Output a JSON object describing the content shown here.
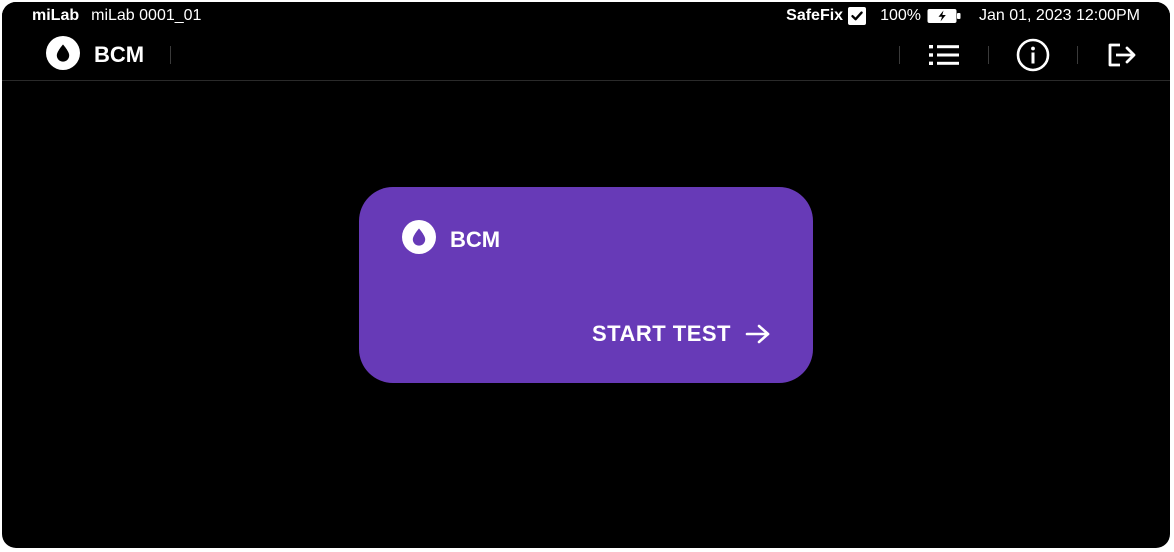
{
  "status_bar": {
    "app_name": "miLab",
    "device_id": "miLab 0001_01",
    "safefix_label": "SafeFix",
    "safefix_checked": true,
    "battery_percent": "100%",
    "battery_icon": "battery-charging-icon",
    "datetime": "Jan 01, 2023 12:00PM"
  },
  "header": {
    "title": "BCM",
    "title_icon": "drop-icon",
    "actions": [
      {
        "name": "list",
        "icon": "list-icon"
      },
      {
        "name": "info",
        "icon": "info-icon"
      },
      {
        "name": "logout",
        "icon": "logout-icon"
      }
    ]
  },
  "card": {
    "title": "BCM",
    "icon": "drop-icon",
    "action_label": "START TEST",
    "action_icon": "arrow-right-icon",
    "color": "#673ab7"
  },
  "colors": {
    "background": "#000000",
    "accent": "#673ab7",
    "text": "#ffffff"
  }
}
